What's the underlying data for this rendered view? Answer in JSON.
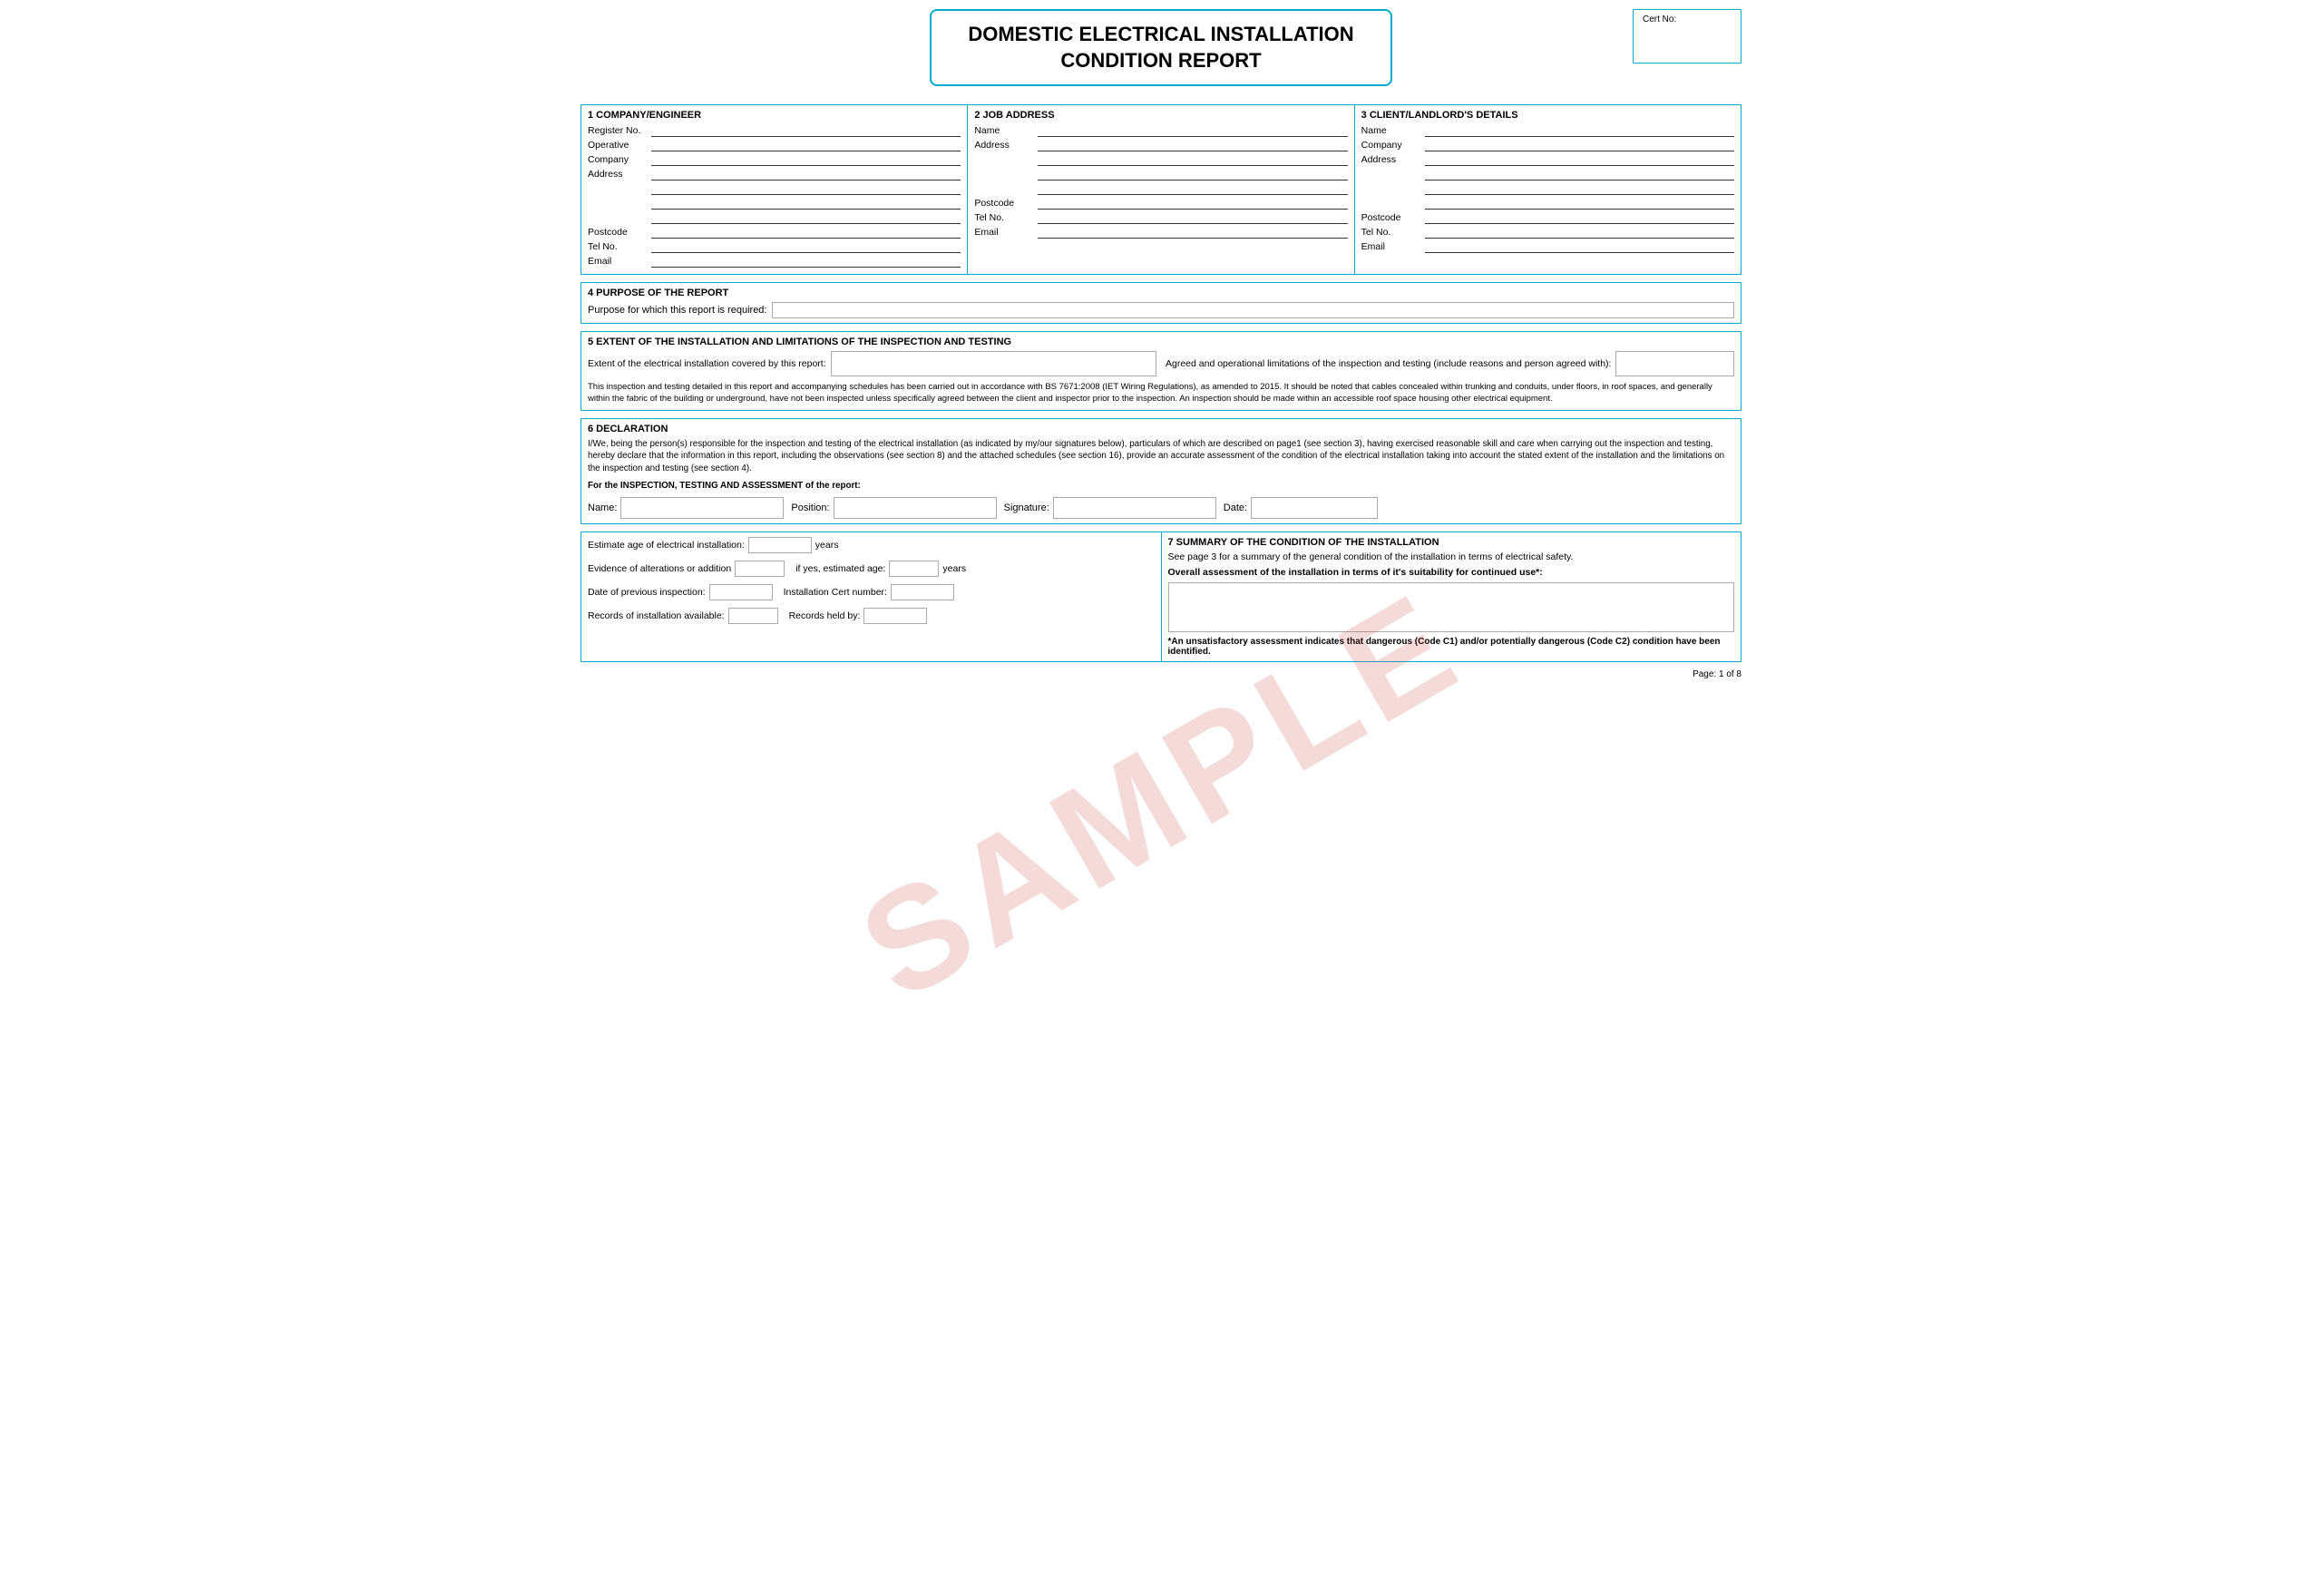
{
  "title": {
    "line1": "DOMESTIC ELECTRICAL INSTALLATION",
    "line2": "CONDITION REPORT",
    "cert_label": "Cert No:"
  },
  "section1": {
    "header": "1  COMPANY/ENGINEER",
    "fields": [
      {
        "label": "Register No.",
        "value": ""
      },
      {
        "label": "Operative",
        "value": ""
      },
      {
        "label": "Company",
        "value": ""
      },
      {
        "label": "Address",
        "value": ""
      },
      {
        "label": "",
        "value": ""
      },
      {
        "label": "",
        "value": ""
      },
      {
        "label": "",
        "value": ""
      },
      {
        "label": "Postcode",
        "value": ""
      },
      {
        "label": "Tel No.",
        "value": ""
      },
      {
        "label": "Email",
        "value": ""
      }
    ]
  },
  "section2": {
    "header": "2  JOB ADDRESS",
    "fields": [
      {
        "label": "Name",
        "value": ""
      },
      {
        "label": "Address",
        "value": ""
      },
      {
        "label": "",
        "value": ""
      },
      {
        "label": "",
        "value": ""
      },
      {
        "label": "",
        "value": ""
      },
      {
        "label": "Postcode",
        "value": ""
      },
      {
        "label": "Tel No.",
        "value": ""
      },
      {
        "label": "Email",
        "value": ""
      }
    ]
  },
  "section3": {
    "header": "3  CLIENT/LANDLORD'S DETAILS",
    "fields": [
      {
        "label": "Name",
        "value": ""
      },
      {
        "label": "Company",
        "value": ""
      },
      {
        "label": "Address",
        "value": ""
      },
      {
        "label": "",
        "value": ""
      },
      {
        "label": "",
        "value": ""
      },
      {
        "label": "",
        "value": ""
      },
      {
        "label": "Postcode",
        "value": ""
      },
      {
        "label": "Tel No.",
        "value": ""
      },
      {
        "label": "Email",
        "value": ""
      }
    ]
  },
  "section4": {
    "header": "4  PURPOSE OF THE REPORT",
    "label": "Purpose for which this report is required:"
  },
  "section5": {
    "header": "5  EXTENT OF THE INSTALLATION AND LIMITATIONS OF THE INSPECTION AND TESTING",
    "label1": "Extent of the electrical installation covered by this report:",
    "label2": "Agreed and operational limitations of the inspection and testing (include reasons and person agreed with):",
    "body": "This inspection and testing detailed in this report and accompanying schedules has been carried out in accordance with BS 7671:2008 (IET Wiring Regulations), as amended to 2015. It should be noted that cables concealed within trunking and conduits, under floors, in roof spaces, and generally within the fabric of the building or underground, have not been inspected unless specifically agreed between the client and inspector prior to the inspection. An inspection should be made within an accessible roof space housing other electrical equipment."
  },
  "section6": {
    "header": "6  DECLARATION",
    "body": "I/We, being the person(s) responsible for the inspection and testing of the electrical installation (as indicated by my/our signatures below), particulars of which are described on page1 (see section 3), having exercised reasonable skill and care when carrying out the inspection and testing, hereby declare that the information in this report, including the observations (see section 8) and the attached schedules (see section 16), provide an accurate assessment of the condition of the electrical installation taking into account the stated extent of the installation and the limitations on the inspection and testing (see section 4).",
    "bold_line": "For the INSPECTION, TESTING AND ASSESSMENT of the report:",
    "name_label": "Name:",
    "position_label": "Position:",
    "signature_label": "Signature:",
    "date_label": "Date:"
  },
  "section7": {
    "left": {
      "est_age_label": "Estimate age of electrical installation:",
      "est_age_unit": "years",
      "evidence_label": "Evidence of alterations or addition",
      "if_yes_label": "if yes, estimated age:",
      "if_yes_unit": "years",
      "prev_inspection_label": "Date of previous inspection:",
      "inst_cert_label": "Installation Cert number:",
      "records_label": "Records of installation available:",
      "records_held_label": "Records held by:"
    },
    "right": {
      "header": "7  SUMMARY OF THE CONDITION OF THE INSTALLATION",
      "intro": "See page 3 for a summary of the general condition of the installation in terms of electrical safety.",
      "overall_label": "Overall assessment of the installation in terms of it's suitability for continued use*:",
      "footnote": "*An unsatisfactory assessment indicates that dangerous (Code C1) and/or potentially dangerous (Code C2) condition have been identified."
    }
  },
  "page_num": "Page: 1 of 8",
  "watermark": "SAMPLE"
}
